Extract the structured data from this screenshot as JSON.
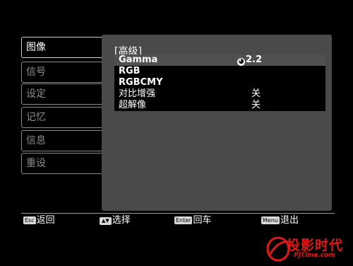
{
  "sidebar": {
    "items": [
      {
        "label": "图像",
        "active": true
      },
      {
        "label": "信号",
        "active": false
      },
      {
        "label": "设定",
        "active": false
      },
      {
        "label": "记忆",
        "active": false
      },
      {
        "label": "信息",
        "active": false
      },
      {
        "label": "重设",
        "active": false
      }
    ]
  },
  "panel": {
    "title": "[高级]",
    "settings": [
      {
        "name": "Gamma",
        "value": "2.2",
        "icon": "gamma-dial-icon",
        "selected": true
      },
      {
        "name": "RGB",
        "value": ""
      },
      {
        "name": "RGBCMY",
        "value": ""
      },
      {
        "name": "对比增强",
        "value": "关"
      },
      {
        "name": "超解像",
        "value": "关"
      }
    ]
  },
  "help_bar": {
    "items": [
      {
        "key": "Esc",
        "label": "返回"
      },
      {
        "key": "▲▼",
        "label": "选择"
      },
      {
        "key": "Enter",
        "label": "回车"
      },
      {
        "key": "Menu",
        "label": "退出"
      }
    ]
  },
  "watermark": {
    "text": "投影时代",
    "url": "PjTime.com"
  },
  "colors": {
    "background": "#000000",
    "panel": "#4a4a4a",
    "selected_row": "#505050",
    "inactive_text": "#8c8c8c",
    "watermark": "#e01818"
  }
}
